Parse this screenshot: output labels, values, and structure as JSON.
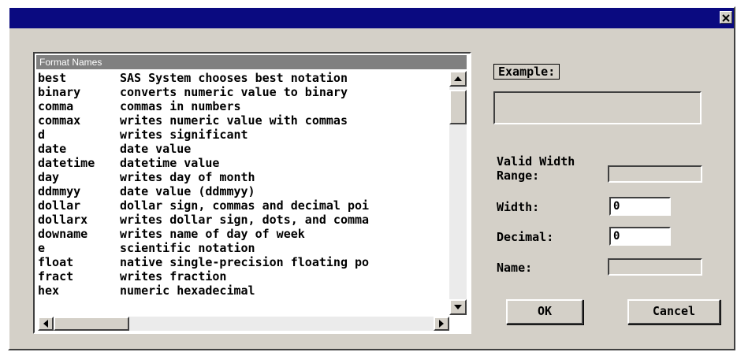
{
  "window": {
    "title": "",
    "close_glyph": "✕",
    "titlebar_color": "#0a0a80",
    "background_color": "#d4d0c8"
  },
  "format_list": {
    "header": "Format Names",
    "items": [
      {
        "name": "best",
        "description": "SAS System chooses best notation"
      },
      {
        "name": "binary",
        "description": "converts numeric value to binary"
      },
      {
        "name": "comma",
        "description": "commas in numbers"
      },
      {
        "name": "commax",
        "description": "writes numeric value with commas"
      },
      {
        "name": "d",
        "description": "writes significant"
      },
      {
        "name": "date",
        "description": "date value"
      },
      {
        "name": "datetime",
        "description": "datetime value"
      },
      {
        "name": "day",
        "description": "writes day of month"
      },
      {
        "name": "ddmmyy",
        "description": "date value (ddmmyy)"
      },
      {
        "name": "dollar",
        "description": "dollar sign, commas and decimal poi"
      },
      {
        "name": "dollarx",
        "description": "writes dollar sign, dots, and comma"
      },
      {
        "name": "downame",
        "description": "writes name of day of week"
      },
      {
        "name": "e",
        "description": "scientific notation"
      },
      {
        "name": "float",
        "description": "native single-precision floating po"
      },
      {
        "name": "fract",
        "description": "writes fraction"
      },
      {
        "name": "hex",
        "description": "numeric hexadecimal"
      }
    ]
  },
  "example": {
    "label": "Example:",
    "value": ""
  },
  "valid_width_range": {
    "label_line1": "Valid Width",
    "label_line2": "Range:",
    "value": ""
  },
  "width": {
    "label": "Width:",
    "value": "0"
  },
  "decimal": {
    "label": "Decimal:",
    "value": "0"
  },
  "name": {
    "label": "Name:",
    "value": ""
  },
  "buttons": {
    "ok": "OK",
    "cancel": "Cancel"
  },
  "icons": {
    "close": "close-icon",
    "scroll_up": "arrow-up-icon",
    "scroll_down": "arrow-down-icon",
    "scroll_left": "arrow-left-icon",
    "scroll_right": "arrow-right-icon"
  }
}
